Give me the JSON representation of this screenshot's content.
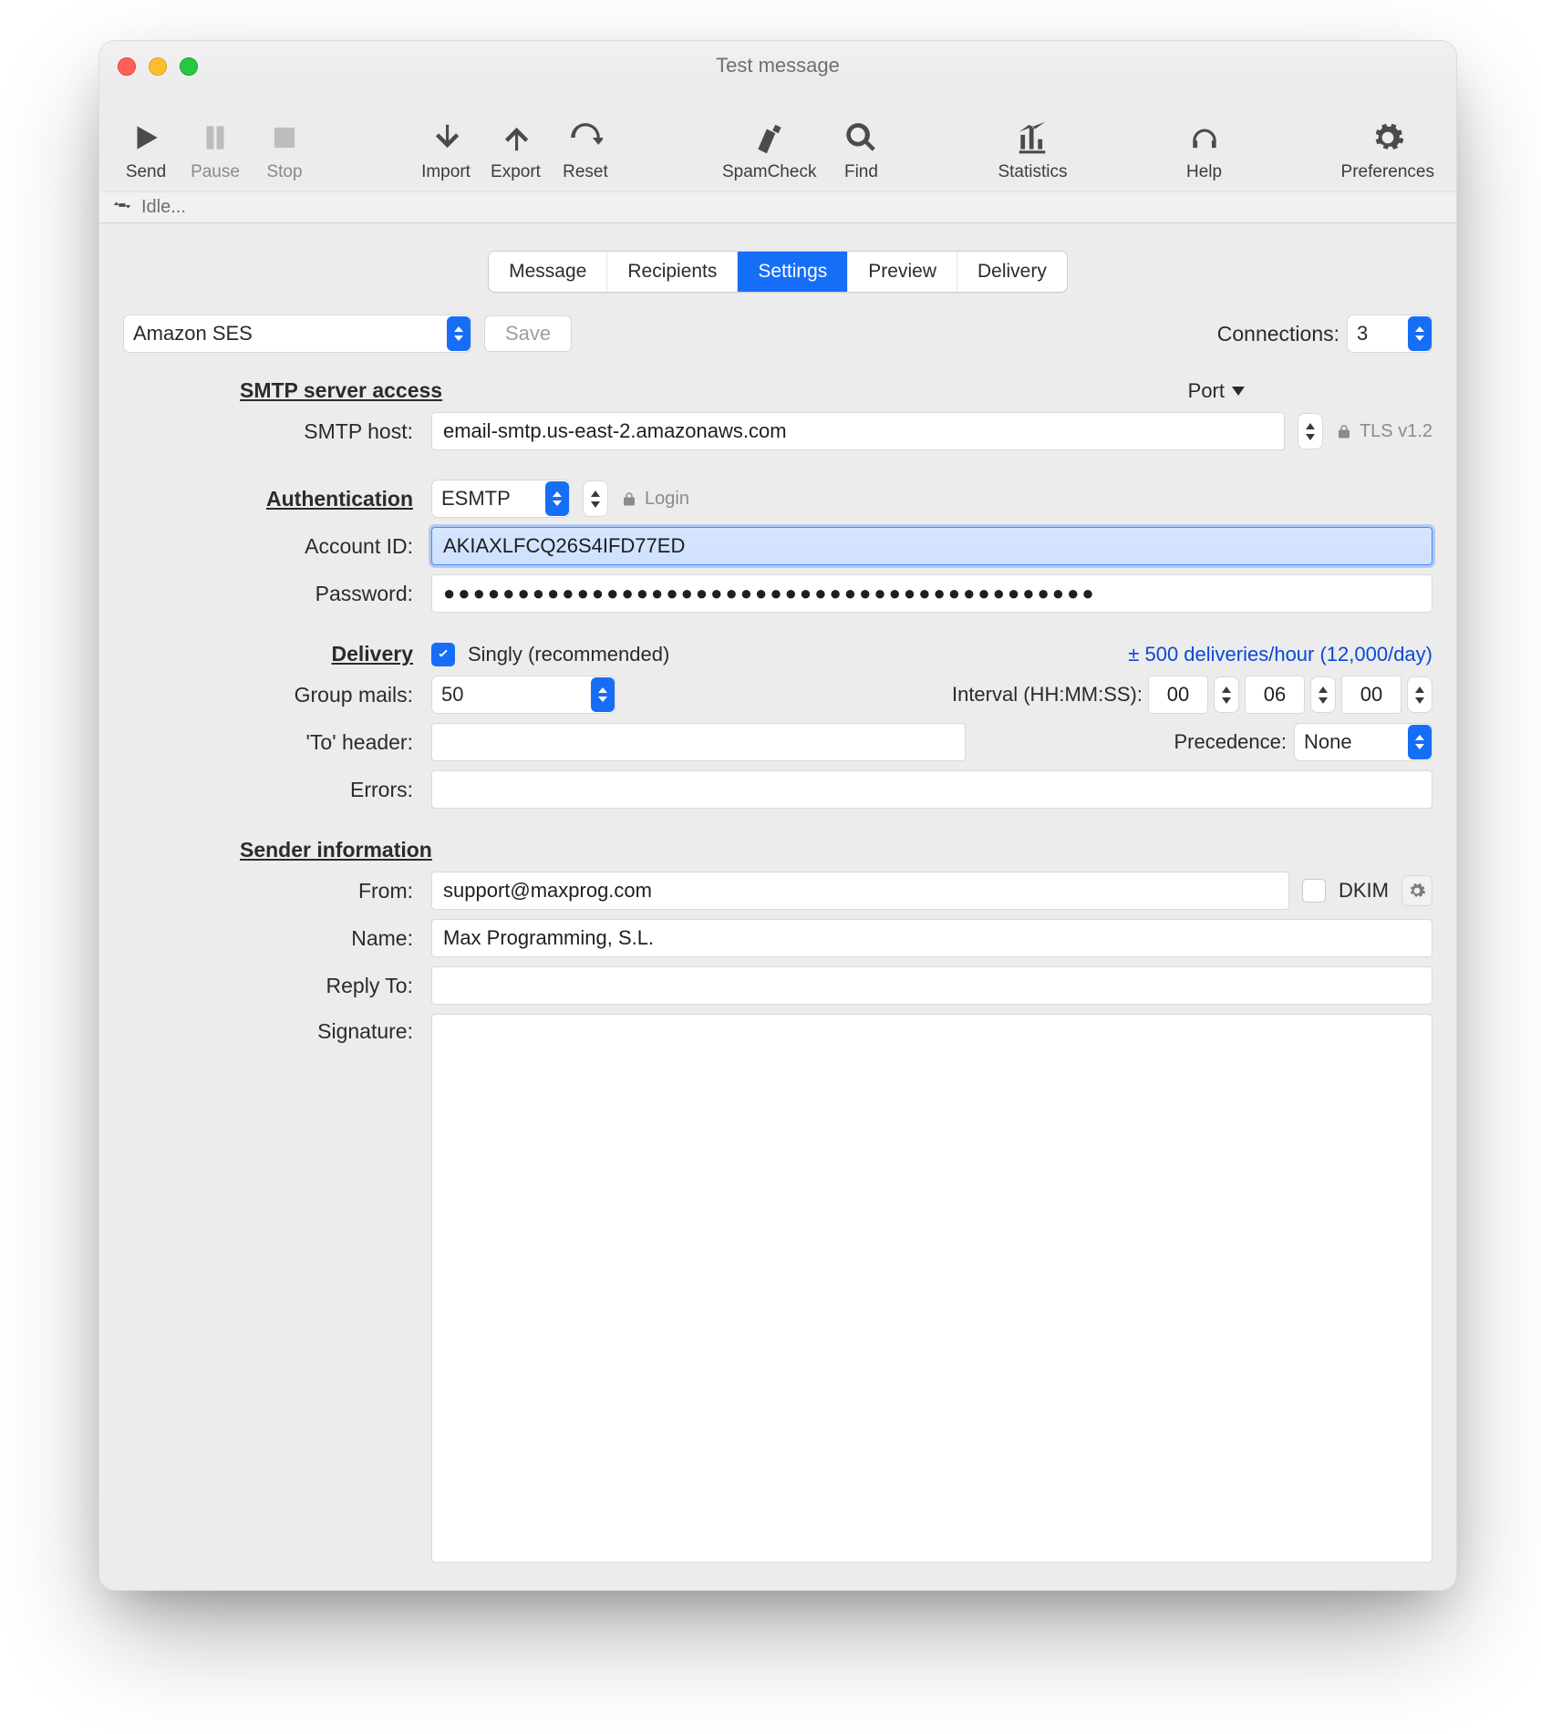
{
  "title": "Test message",
  "toolbar": {
    "send": "Send",
    "pause": "Pause",
    "stop": "Stop",
    "import": "Import",
    "export": "Export",
    "reset": "Reset",
    "spamcheck": "SpamCheck",
    "find": "Find",
    "statistics": "Statistics",
    "help": "Help",
    "preferences": "Preferences"
  },
  "status": "Idle...",
  "tabs": {
    "message": "Message",
    "recipients": "Recipients",
    "settings": "Settings",
    "preview": "Preview",
    "delivery": "Delivery"
  },
  "provider": "Amazon SES",
  "saveLabel": "Save",
  "connections": {
    "label": "Connections:",
    "value": "3"
  },
  "sections": {
    "server": "SMTP server access",
    "auth": "Authentication",
    "delivery": "Delivery",
    "sender": "Sender information"
  },
  "labels": {
    "smtpHost": "SMTP host:",
    "accountId": "Account ID:",
    "password": "Password:",
    "groupMails": "Group mails:",
    "toHeader": "'To' header:",
    "errors": "Errors:",
    "from": "From:",
    "name": "Name:",
    "replyTo": "Reply To:",
    "signature": "Signature:",
    "precedence": "Precedence:",
    "interval": "Interval (HH:MM:SS):",
    "port": "Port",
    "tls": "TLS v1.2",
    "login": "Login",
    "dkim": "DKIM"
  },
  "values": {
    "smtpHost": "email-smtp.us-east-2.amazonaws.com",
    "accountId": "AKIAXLFCQ26S4IFD77ED",
    "password": "●●●●●●●●●●●●●●●●●●●●●●●●●●●●●●●●●●●●●●●●●●●●",
    "authMethod": "ESMTP",
    "singly": "Singly (recommended)",
    "rate": "± 500 deliveries/hour (12,000/day)",
    "groupMails": "50",
    "hh": "00",
    "mm": "06",
    "ss": "00",
    "precedence": "None",
    "from": "support@maxprog.com",
    "name": "Max Programming, S.L.",
    "replyTo": "",
    "errors": "",
    "toHeader": "",
    "signature": ""
  }
}
